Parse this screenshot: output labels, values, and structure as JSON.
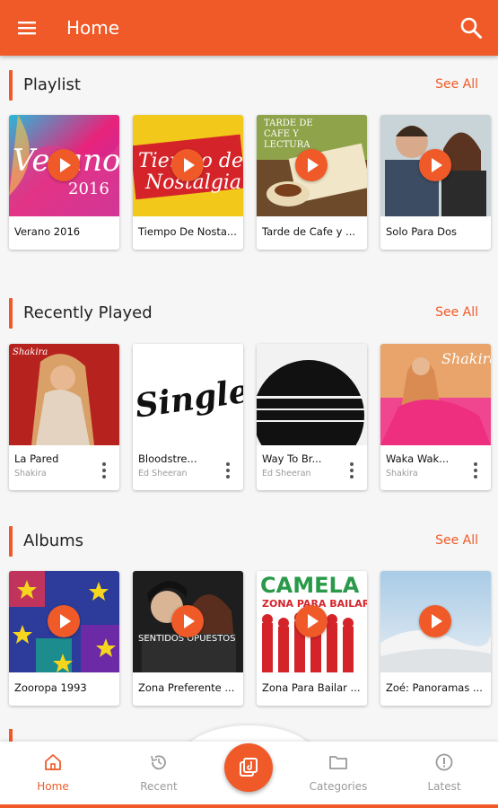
{
  "colors": {
    "accent": "#f05a28"
  },
  "appbar": {
    "title": "Home",
    "menu_icon": "hamburger-icon",
    "search_icon": "search-icon"
  },
  "sections": {
    "playlist": {
      "title": "Playlist",
      "see_all": "See All",
      "items": [
        {
          "name": "Verano 2016",
          "cover_text": "Verano 2016"
        },
        {
          "name": "Tiempo De Nosta...",
          "cover_text": "Tiempo de Nostalgia"
        },
        {
          "name": "Tarde de Cafe y ...",
          "cover_text": "TARDE DE CAFE Y LECTURA"
        },
        {
          "name": "Solo Para Dos",
          "cover_text": ""
        }
      ]
    },
    "recent": {
      "title": "Recently Played",
      "see_all": "See All",
      "items": [
        {
          "name": "La Pared",
          "artist": "Shakira",
          "cover_text": "Shakira"
        },
        {
          "name": "Bloodstre...",
          "artist": "Ed Sheeran",
          "cover_text": "Singles"
        },
        {
          "name": "Way To Br...",
          "artist": "Ed Sheeran",
          "cover_text": ""
        },
        {
          "name": "Waka Wak...",
          "artist": "Shakira",
          "cover_text": "Shakira"
        }
      ]
    },
    "albums": {
      "title": "Albums",
      "see_all": "See All",
      "items": [
        {
          "name": "Zooropa 1993",
          "cover_text": ""
        },
        {
          "name": "Zona Preferente ...",
          "cover_text": "SENTIDOS OPUESTOS"
        },
        {
          "name": "Zona Para Bailar ...",
          "cover_text": "CAMELA ZONA PARA BAILAR"
        },
        {
          "name": "Zoé: Panoramas ...",
          "cover_text": ""
        }
      ]
    }
  },
  "bottom_nav": {
    "home": "Home",
    "recent": "Recent",
    "categories": "Categories",
    "latest": "Latest"
  }
}
